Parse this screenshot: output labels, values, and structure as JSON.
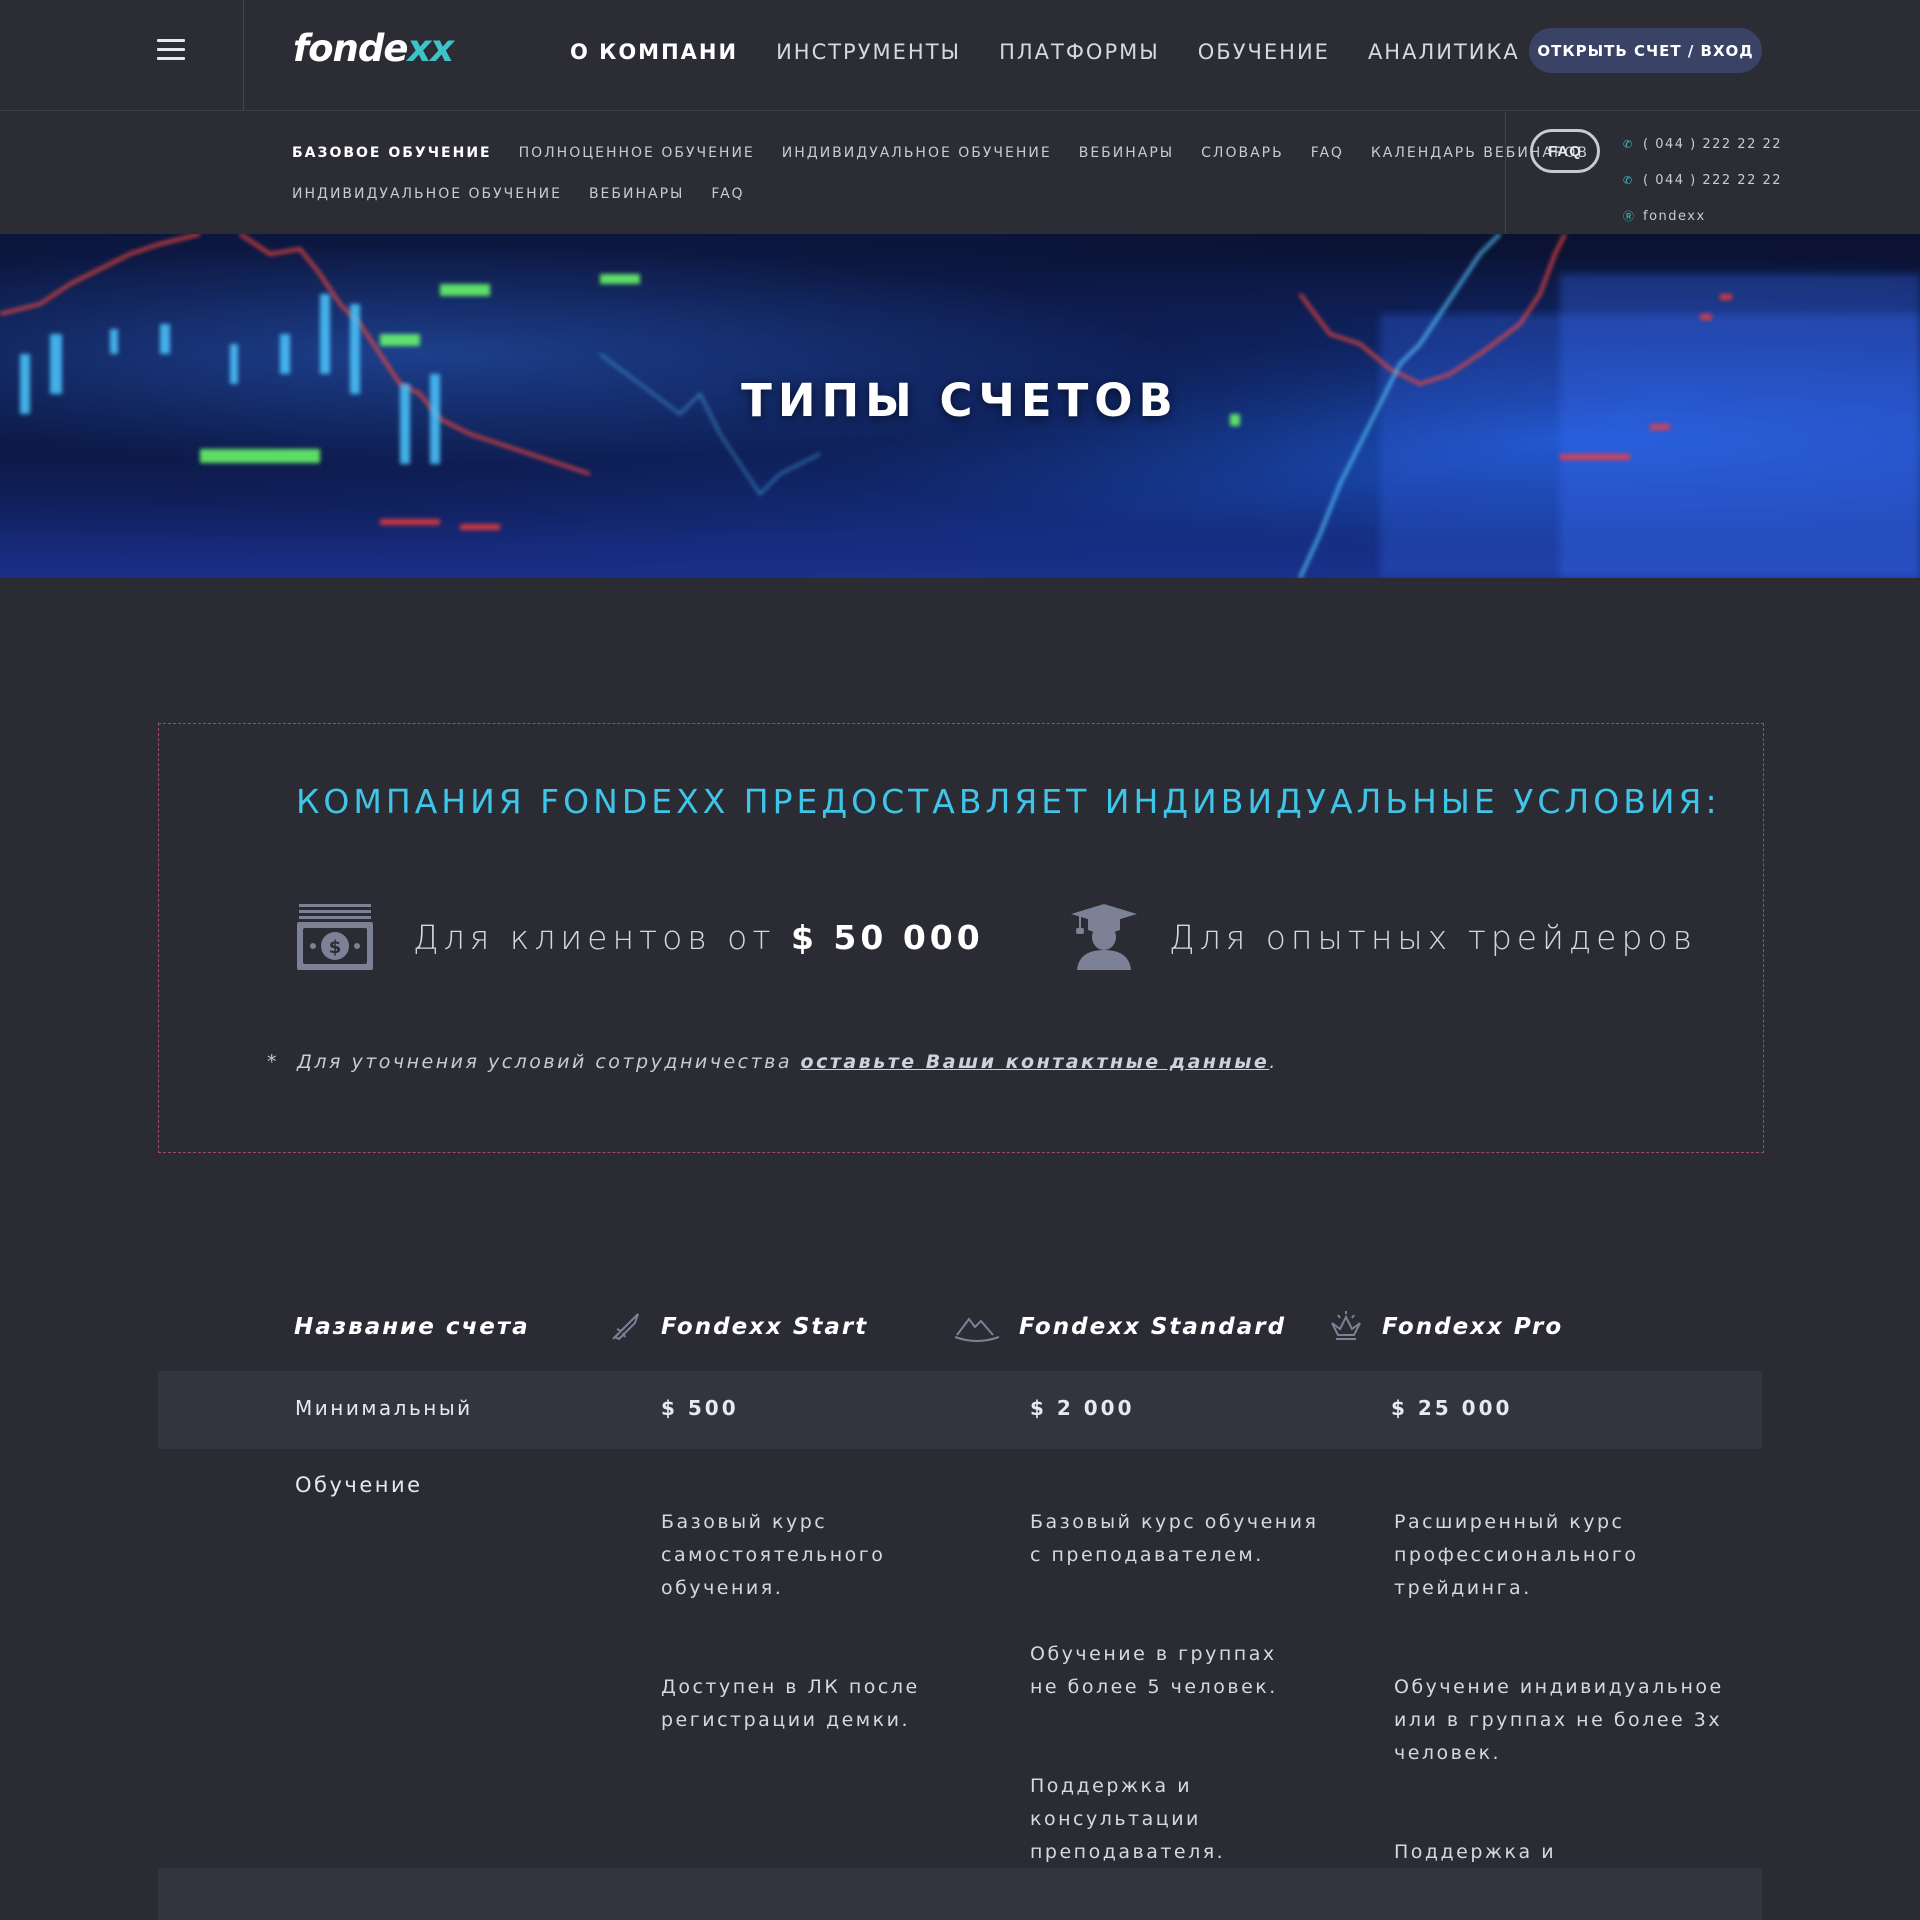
{
  "header": {
    "logo_main": "fonde",
    "logo_accent": "xx",
    "nav": [
      {
        "label": "О КОМПАНИ",
        "active": true
      },
      {
        "label": "ИНСТРУМЕНТЫ"
      },
      {
        "label": "ПЛАТФОРМЫ"
      },
      {
        "label": "ОБУЧЕНИЕ"
      },
      {
        "label": "АНАЛИТИКА"
      }
    ],
    "cta_label": "ОТКРЫТЬ СЧЕТ / ВХОД"
  },
  "subnav": {
    "row1": [
      "БАЗОВОЕ ОБУЧЕНИЕ",
      "ПОЛНОЦЕННОЕ ОБУЧЕНИЕ",
      "ИНДИВИДУАЛЬНОЕ ОБУЧЕНИЕ",
      "ВЕБИНАРЫ",
      "СЛОВАРЬ",
      "FAQ",
      "КАЛЕНДАРЬ ВЕБИНАРОВ"
    ],
    "row2": [
      "ИНДИВИДУАЛЬНОЕ ОБУЧЕНИЕ",
      "ВЕБИНАРЫ",
      "FAQ"
    ],
    "faq_button": "FAQ",
    "phone1": "( 044 ) 222 22 22",
    "phone2": "( 044 ) 222 22 22",
    "skype": "fondexx"
  },
  "hero": {
    "title": "ТИПЫ СЧЕТОВ"
  },
  "conditions": {
    "heading": "КОМПАНИЯ FONDEXX ПРЕДОСТАВЛЯЕТ ИНДИВИДУАЛЬНЫЕ УСЛОВИЯ:",
    "feature1_text": "Для клиентов от ",
    "feature1_amount": "$ 50 000",
    "feature2_text": "Для опытных трейдеров",
    "note_star": "*",
    "note_text": "Для уточнения условий сотрудничества ",
    "note_link": "оставьте Ваши контактные данные",
    "note_end": "."
  },
  "table": {
    "header_label": "Название счета",
    "plans": [
      {
        "name": "Fondexx Start",
        "icon": "rocket-icon",
        "min": "$ 500",
        "education": [
          "Базовый курс\nсамостоятельного\nобучения.",
          "Доступен в ЛК после\nрегистрации демки."
        ]
      },
      {
        "name": "Fondexx Standard",
        "icon": "mountain-icon",
        "min": "$ 2 000",
        "education": [
          "Базовый курс обучения\nс преподавателем.",
          "Обучение в группах\nне более 5 человек.",
          "Поддержка и\nконсультации\nпреподавателя."
        ]
      },
      {
        "name": "Fondexx Pro",
        "icon": "crown-icon",
        "min": "$ 25 000",
        "education": [
          "Расширенный курс\nпрофессионального\nтрейдинга.",
          "Обучение индивидуальное\nили в группах не более 3х\nчеловек.",
          "Поддержка и\nсопровождение."
        ]
      }
    ],
    "row_min_label": "Минимальный",
    "row_edu_label": "Обучение"
  },
  "colors": {
    "accent": "#3ec5e8",
    "logo_accent": "#3ec3c9",
    "cta_bg": "#3a4266",
    "page_bg": "#2a2b33",
    "dashed_border": "#a34a63"
  }
}
